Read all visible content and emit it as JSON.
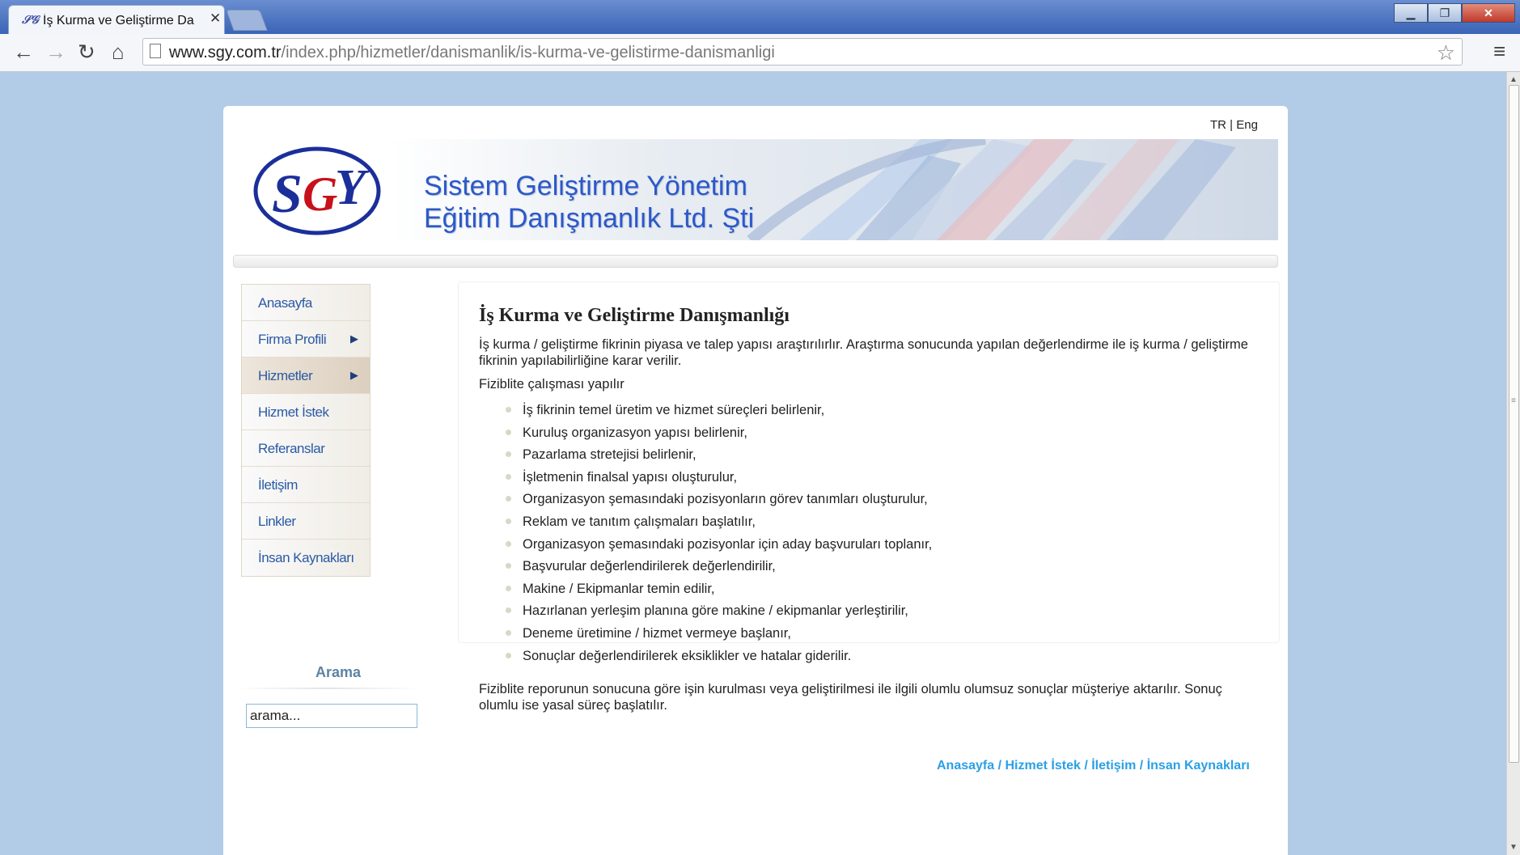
{
  "browser": {
    "tab_title": "İş Kurma ve Geliştirme Da",
    "tab_favicon": "sgy-favicon",
    "url_host": "www.sgy.com.tr",
    "url_path": "/index.php/hizmetler/danismanlik/is-kurma-ve-gelistirme-danismanligi"
  },
  "lang": {
    "tr": "TR",
    "sep": " | ",
    "en": "Eng"
  },
  "header": {
    "company_line1": "Sistem Geliştirme Yönetim",
    "company_line2": "Eğitim Danışmanlık Ltd. Şti"
  },
  "nav": {
    "items": [
      {
        "label": "Anasayfa"
      },
      {
        "label": "Firma Profili"
      },
      {
        "label": "Hizmetler"
      },
      {
        "label": "Hizmet İstek"
      },
      {
        "label": "Referanslar"
      },
      {
        "label": "İletişim"
      },
      {
        "label": "Linkler"
      },
      {
        "label": "İnsan Kaynakları"
      }
    ]
  },
  "search": {
    "title": "Arama",
    "placeholder": "arama..."
  },
  "content": {
    "title": "İş Kurma ve Geliştirme Danışmanlığı",
    "intro": "İş kurma / geliştirme fikrinin piyasa ve talep yapısı araştırılırlır. Araştırma sonucunda yapılan değerlendirme ile iş kurma / geliştirme fikrinin yapılabilirliğine karar verilir.",
    "subtitle": "Fiziblite çalışması yapılır",
    "items": [
      "İş fikrinin temel üretim ve hizmet süreçleri belirlenir,",
      "Kuruluş organizasyon yapısı belirlenir,",
      "Pazarlama stretejisi belirlenir,",
      "İşletmenin finalsal yapısı oluşturulur,",
      "Organizasyon şemasındaki pozisyonların görev tanımları oluşturulur,",
      "Reklam ve tanıtım çalışmaları başlatılır,",
      "Organizasyon şemasındaki pozisyonlar için aday başvuruları toplanır,",
      "Başvurular değerlendirilerek değerlendirilir,",
      "Makine / Ekipmanlar temin edilir,",
      "Hazırlanan yerleşim planına göre makine / ekipmanlar yerleştirilir,",
      "Deneme üretimine / hizmet vermeye başlanır,",
      "Sonuçlar değerlendirilerek eksiklikler ve hatalar giderilir."
    ],
    "conclusion": "Fiziblite reporunun sonucuna göre işin kurulması veya geliştirilmesi ile ilgili olumlu olumsuz sonuçlar müşteriye aktarılır. Sonuç olumlu ise yasal süreç başlatılır."
  },
  "footer": {
    "links": [
      "Anasayfa",
      "Hizmet İstek",
      "İletişim",
      "İnsan Kaynakları"
    ],
    "separator": " / "
  }
}
